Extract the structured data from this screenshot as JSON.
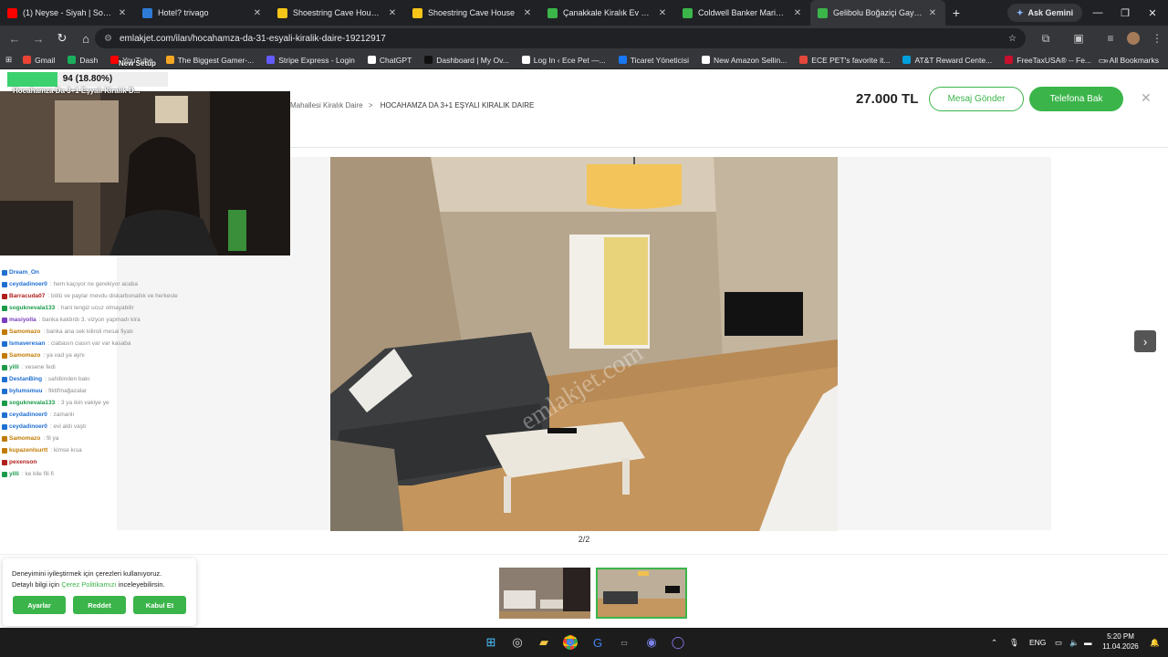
{
  "browser": {
    "tabs": [
      {
        "label": "(1) Neyse - Siyah | Sofar İsta",
        "color": "#ff0000"
      },
      {
        "label": "Hotel? trivago",
        "color": "#2e7bd6"
      },
      {
        "label": "Shoestring Cave House Hote",
        "color": "#f5c518"
      },
      {
        "label": "Shoestring Cave House",
        "color": "#f5c518"
      },
      {
        "label": "Çanakkale Kiralık Ev Fiyatları",
        "color": "#3bb54a"
      },
      {
        "label": "Coldwell Banker Marina Mu",
        "color": "#3bb54a"
      },
      {
        "label": "Gelibolu Boğaziçi Gayrimenk",
        "color": "#3bb54a",
        "active": true
      }
    ],
    "ask_gemini": "Ask Gemini",
    "url": "emlakjet.com/ilan/hocahamza-da-31-esyali-kiralik-daire-19212917",
    "bookmarks": [
      {
        "label": "Gmail",
        "color": "#ea4335"
      },
      {
        "label": "Dash",
        "color": "#1aaf5d"
      },
      {
        "label": "YouTube",
        "color": "#ff0000"
      },
      {
        "label": "The Biggest Gamer-...",
        "color": "#f5a623"
      },
      {
        "label": "Stripe Express - Login",
        "color": "#635bff"
      },
      {
        "label": "ChatGPT",
        "color": "#ffffff"
      },
      {
        "label": "Dashboard | My Ov...",
        "color": "#111111"
      },
      {
        "label": "Log In ‹ Ece Pet —...",
        "color": "#ffffff"
      },
      {
        "label": "Ticaret Yöneticisi",
        "color": "#1877f2"
      },
      {
        "label": "New Amazon Sellin...",
        "color": "#ffffff"
      },
      {
        "label": "ECE PET's favorite it...",
        "color": "#e4473c"
      },
      {
        "label": "AT&T Reward Cente...",
        "color": "#009fdb"
      },
      {
        "label": "FreeTaxUSA® -- Fe...",
        "color": "#c8102e"
      }
    ],
    "all_bookmarks": "All Bookmarks"
  },
  "listing": {
    "breadcrumb_prev": "Mahallesi Kiralık Daire",
    "breadcrumb_current": "HOCAHAMZA DA 3+1 EŞYALI KIRALIK DAIRE",
    "price": "27.000 TL",
    "message_button": "Mesaj Gönder",
    "call_button": "Telefona Bak",
    "watermark": "emlakjet.com",
    "photo_counter": "2/2"
  },
  "cookie": {
    "line1": "Deneyimini iyileştirmek için çerezleri kullanıyoruz.",
    "line2_prefix": "Detaylı bilgi için ",
    "line2_link": "Çerez Politikamızı",
    "line2_suffix": " inceleyebilirsin.",
    "settings": "Ayarlar",
    "reject": "Reddet",
    "accept": "Kabul Et"
  },
  "stream": {
    "goal_text": "94 (18.80%)",
    "goal_fraction": 0.188,
    "new_setup": "New Setup",
    "cam_title": "Hocahamza Da 3+1 Eşyalı Kiralık D...",
    "chat": [
      {
        "user": "Dream_On",
        "color": "#1f6fd1",
        "msg": ""
      },
      {
        "user": "ceydadinoer0",
        "color": "#1f6fd1",
        "msg": ": hem kaçıyor ne gerekiyor acaba"
      },
      {
        "user": "Barracuda07",
        "color": "#b01e1e",
        "msg": ": bölü ve paylar mevdu diskarbonatlık ve herkesle"
      },
      {
        "user": "soguknevala133",
        "color": "#1a9a4a",
        "msg": ": hani tengiz ucuz olmayabilir"
      },
      {
        "user": "masiyolla",
        "color": "#7a3fbf",
        "msg": ": banka kaldırdı 3. vizyon yapmadı kira"
      },
      {
        "user": "Samomazo",
        "color": "#c07a00",
        "msg": ": banka ana sek kiliroli mesai fiyatı"
      },
      {
        "user": "Ismaveresan",
        "color": "#1f6fd1",
        "msg": ": ciabasın ciasın var var kasaba"
      },
      {
        "user": "Samomazo",
        "color": "#c07a00",
        "msg": ": ya vad ya aynı"
      },
      {
        "user": "yilli",
        "color": "#1a9a4a",
        "msg": ": vesene fedi"
      },
      {
        "user": "DestanBing",
        "color": "#1f6fd1",
        "msg": ": sahibinden bakı"
      },
      {
        "user": "bylumsmuu",
        "color": "#1f6fd1",
        "msg": ": fiktifmağazalar"
      },
      {
        "user": "soguknevala133",
        "color": "#1a9a4a",
        "msg": ": 3 ya ikin vakiye ye"
      },
      {
        "user": "ceydadinoer0",
        "color": "#1f6fd1",
        "msg": ": zamanlı"
      },
      {
        "user": "ceydadinoer0",
        "color": "#1f6fd1",
        "msg": ": evi aldı vaştı"
      },
      {
        "user": "Samomazo",
        "color": "#c07a00",
        "msg": ": fil ya"
      },
      {
        "user": "kupazenlsurtt",
        "color": "#c07a00",
        "msg": ": kimse kısa"
      },
      {
        "user": "pexenson",
        "color": "#b01e1e",
        "msg": ""
      },
      {
        "user": "yilli",
        "color": "#1a9a4a",
        "msg": ": ke kile fili fi"
      }
    ]
  },
  "taskbar": {
    "lang": "ENG",
    "time": "5:20 PM",
    "date": "11.04.2026"
  }
}
